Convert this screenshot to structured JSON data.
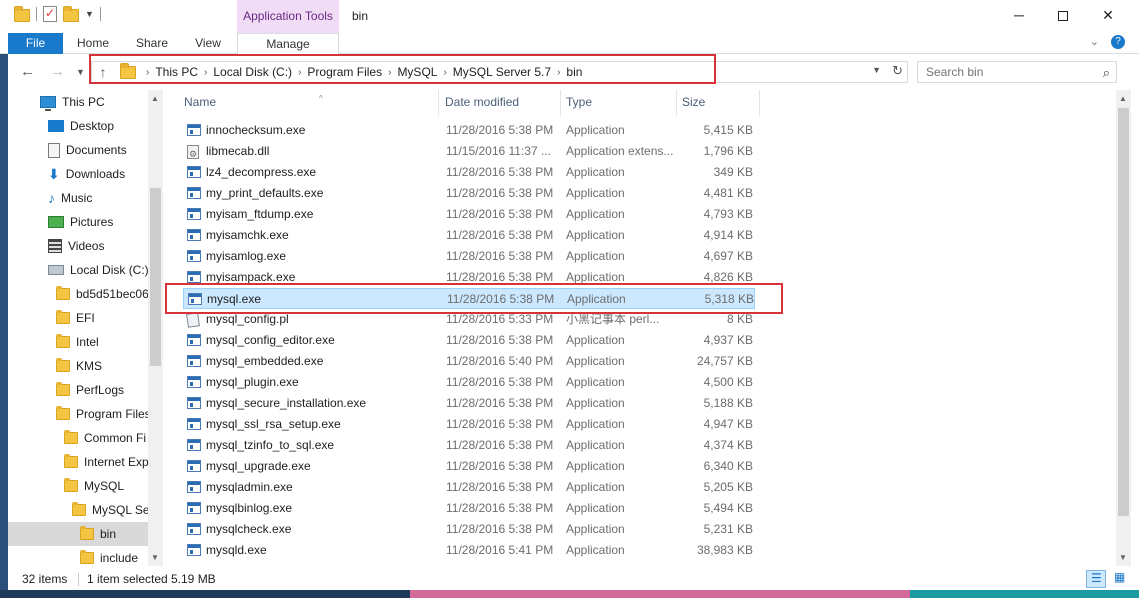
{
  "window": {
    "title": "bin",
    "context_group": "Application Tools",
    "controls": {
      "minimize": "─",
      "close": "✕"
    }
  },
  "ribbon": {
    "tabs": [
      {
        "label": "File"
      },
      {
        "label": "Home"
      },
      {
        "label": "Share"
      },
      {
        "label": "View"
      },
      {
        "label": "Manage"
      }
    ]
  },
  "address": {
    "crumbs": [
      "This PC",
      "Local Disk (C:)",
      "Program Files",
      "MySQL",
      "MySQL Server 5.7",
      "bin"
    ],
    "separator": "›"
  },
  "search": {
    "placeholder": "Search bin"
  },
  "nav_pane": {
    "items": [
      {
        "label": "This PC",
        "icon": "pc-icon",
        "indent": 0
      },
      {
        "label": "Desktop",
        "icon": "desktop-icon",
        "indent": 1
      },
      {
        "label": "Documents",
        "icon": "documents-icon",
        "indent": 1
      },
      {
        "label": "Downloads",
        "icon": "downloads-icon",
        "indent": 1
      },
      {
        "label": "Music",
        "icon": "music-icon",
        "indent": 1
      },
      {
        "label": "Pictures",
        "icon": "pictures-icon",
        "indent": 1
      },
      {
        "label": "Videos",
        "icon": "videos-icon",
        "indent": 1
      },
      {
        "label": "Local Disk (C:)",
        "icon": "disk-icon",
        "indent": 1
      },
      {
        "label": "bd5d51bec06",
        "icon": "folder-icon",
        "indent": 2
      },
      {
        "label": "EFI",
        "icon": "folder-icon",
        "indent": 2
      },
      {
        "label": "Intel",
        "icon": "folder-icon",
        "indent": 2
      },
      {
        "label": "KMS",
        "icon": "folder-icon",
        "indent": 2
      },
      {
        "label": "PerfLogs",
        "icon": "folder-icon",
        "indent": 2
      },
      {
        "label": "Program Files",
        "icon": "folder-icon",
        "indent": 2
      },
      {
        "label": "Common Fi",
        "icon": "folder-icon",
        "indent": 3
      },
      {
        "label": "Internet Exp",
        "icon": "folder-icon",
        "indent": 3
      },
      {
        "label": "MySQL",
        "icon": "folder-icon",
        "indent": 3
      },
      {
        "label": "MySQL Se",
        "icon": "folder-icon",
        "indent": 4
      },
      {
        "label": "bin",
        "icon": "folder-icon",
        "indent": 5,
        "selected": true
      },
      {
        "label": "include",
        "icon": "folder-icon",
        "indent": 5
      }
    ]
  },
  "columns": {
    "name": "Name",
    "date": "Date modified",
    "type": "Type",
    "size": "Size"
  },
  "files": [
    {
      "name": "innochecksum.exe",
      "date": "11/28/2016 5:38 PM",
      "type": "Application",
      "size": "5,415 KB",
      "icon": "app"
    },
    {
      "name": "libmecab.dll",
      "date": "11/15/2016 11:37 ...",
      "type": "Application extens...",
      "size": "1,796 KB",
      "icon": "dll"
    },
    {
      "name": "lz4_decompress.exe",
      "date": "11/28/2016 5:38 PM",
      "type": "Application",
      "size": "349 KB",
      "icon": "app"
    },
    {
      "name": "my_print_defaults.exe",
      "date": "11/28/2016 5:38 PM",
      "type": "Application",
      "size": "4,481 KB",
      "icon": "app"
    },
    {
      "name": "myisam_ftdump.exe",
      "date": "11/28/2016 5:38 PM",
      "type": "Application",
      "size": "4,793 KB",
      "icon": "app"
    },
    {
      "name": "myisamchk.exe",
      "date": "11/28/2016 5:38 PM",
      "type": "Application",
      "size": "4,914 KB",
      "icon": "app"
    },
    {
      "name": "myisamlog.exe",
      "date": "11/28/2016 5:38 PM",
      "type": "Application",
      "size": "4,697 KB",
      "icon": "app"
    },
    {
      "name": "myisampack.exe",
      "date": "11/28/2016 5:38 PM",
      "type": "Application",
      "size": "4,826 KB",
      "icon": "app"
    },
    {
      "name": "mysql.exe",
      "date": "11/28/2016 5:38 PM",
      "type": "Application",
      "size": "5,318 KB",
      "icon": "app",
      "selected": true
    },
    {
      "name": "mysql_config.pl",
      "date": "11/28/2016 5:33 PM",
      "type": "小黑记事本 perl...",
      "size": "8 KB",
      "icon": "pl"
    },
    {
      "name": "mysql_config_editor.exe",
      "date": "11/28/2016 5:38 PM",
      "type": "Application",
      "size": "4,937 KB",
      "icon": "app"
    },
    {
      "name": "mysql_embedded.exe",
      "date": "11/28/2016 5:40 PM",
      "type": "Application",
      "size": "24,757 KB",
      "icon": "app"
    },
    {
      "name": "mysql_plugin.exe",
      "date": "11/28/2016 5:38 PM",
      "type": "Application",
      "size": "4,500 KB",
      "icon": "app"
    },
    {
      "name": "mysql_secure_installation.exe",
      "date": "11/28/2016 5:38 PM",
      "type": "Application",
      "size": "5,188 KB",
      "icon": "app"
    },
    {
      "name": "mysql_ssl_rsa_setup.exe",
      "date": "11/28/2016 5:38 PM",
      "type": "Application",
      "size": "4,947 KB",
      "icon": "app"
    },
    {
      "name": "mysql_tzinfo_to_sql.exe",
      "date": "11/28/2016 5:38 PM",
      "type": "Application",
      "size": "4,374 KB",
      "icon": "app"
    },
    {
      "name": "mysql_upgrade.exe",
      "date": "11/28/2016 5:38 PM",
      "type": "Application",
      "size": "6,340 KB",
      "icon": "app"
    },
    {
      "name": "mysqladmin.exe",
      "date": "11/28/2016 5:38 PM",
      "type": "Application",
      "size": "5,205 KB",
      "icon": "app"
    },
    {
      "name": "mysqlbinlog.exe",
      "date": "11/28/2016 5:38 PM",
      "type": "Application",
      "size": "5,494 KB",
      "icon": "app"
    },
    {
      "name": "mysqlcheck.exe",
      "date": "11/28/2016 5:38 PM",
      "type": "Application",
      "size": "5,231 KB",
      "icon": "app"
    },
    {
      "name": "mysqld.exe",
      "date": "11/28/2016 5:41 PM",
      "type": "Application",
      "size": "38,983 KB",
      "icon": "app"
    }
  ],
  "status": {
    "count": "32 items",
    "selected": "1 item selected",
    "selected_size": "5.19 MB"
  },
  "colors": {
    "accent": "#1979ca",
    "highlight": "#d6323a",
    "selection": "#cce8ff",
    "context_tab": "#f0dcf5"
  }
}
